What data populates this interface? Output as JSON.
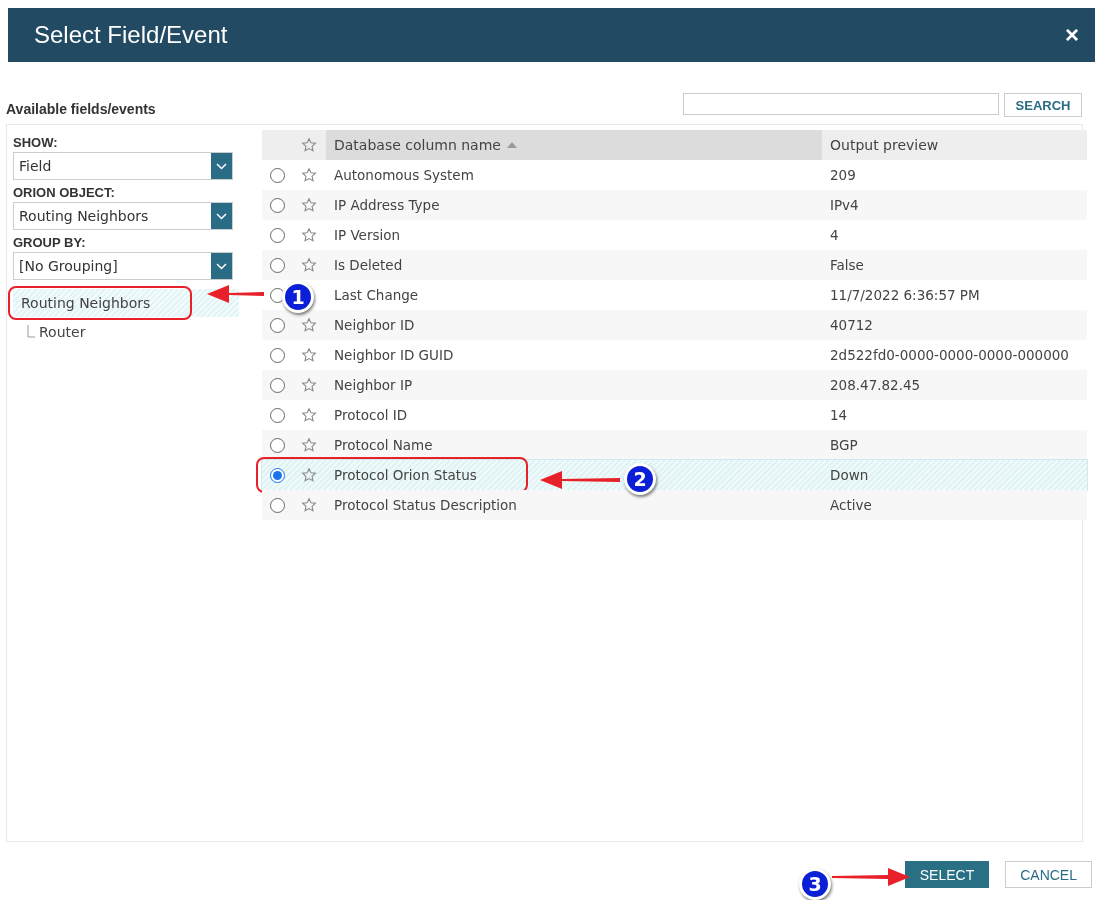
{
  "dialog": {
    "title": "Select Field/Event",
    "close": "×"
  },
  "section_title": "Available fields/events",
  "search": {
    "button": "SEARCH"
  },
  "filters": [
    {
      "label": "SHOW:",
      "value": "Field"
    },
    {
      "label": "ORION OBJECT:",
      "value": "Routing Neighbors"
    },
    {
      "label": "GROUP BY:",
      "value": "[No Grouping]"
    }
  ],
  "tree": [
    {
      "label": "Routing Neighbors",
      "selected": true,
      "highlighted": true,
      "children": [
        {
          "label": "Router",
          "selected": false,
          "highlighted": false
        }
      ]
    }
  ],
  "table": {
    "columns": [
      "Database column name",
      "Output preview"
    ],
    "rows": [
      {
        "name": "Autonomous System",
        "preview": "209",
        "selected": false,
        "highlighted": false
      },
      {
        "name": "IP Address Type",
        "preview": "IPv4",
        "selected": false,
        "highlighted": false
      },
      {
        "name": "IP Version",
        "preview": "4",
        "selected": false,
        "highlighted": false
      },
      {
        "name": "Is Deleted",
        "preview": "False",
        "selected": false,
        "highlighted": false
      },
      {
        "name": "Last Change",
        "preview": "11/7/2022 6:36:57 PM",
        "selected": false,
        "highlighted": false
      },
      {
        "name": "Neighbor ID",
        "preview": "40712",
        "selected": false,
        "highlighted": false
      },
      {
        "name": "Neighbor ID GUID",
        "preview": "2d522fd0-0000-0000-0000-000000",
        "selected": false,
        "highlighted": false
      },
      {
        "name": "Neighbor IP",
        "preview": "208.47.82.45",
        "selected": false,
        "highlighted": false
      },
      {
        "name": "Protocol ID",
        "preview": "14",
        "selected": false,
        "highlighted": false
      },
      {
        "name": "Protocol Name",
        "preview": "BGP",
        "selected": false,
        "highlighted": false
      },
      {
        "name": "Protocol Orion Status",
        "preview": "Down",
        "selected": true,
        "highlighted": true
      },
      {
        "name": "Protocol Status Description",
        "preview": "Active",
        "selected": false,
        "highlighted": false
      }
    ]
  },
  "buttons": [
    {
      "label": "SELECT",
      "kind": "primary"
    },
    {
      "label": "CANCEL",
      "kind": "secondary"
    }
  ],
  "callouts": [
    {
      "number": "1"
    },
    {
      "number": "2"
    },
    {
      "number": "3"
    }
  ]
}
